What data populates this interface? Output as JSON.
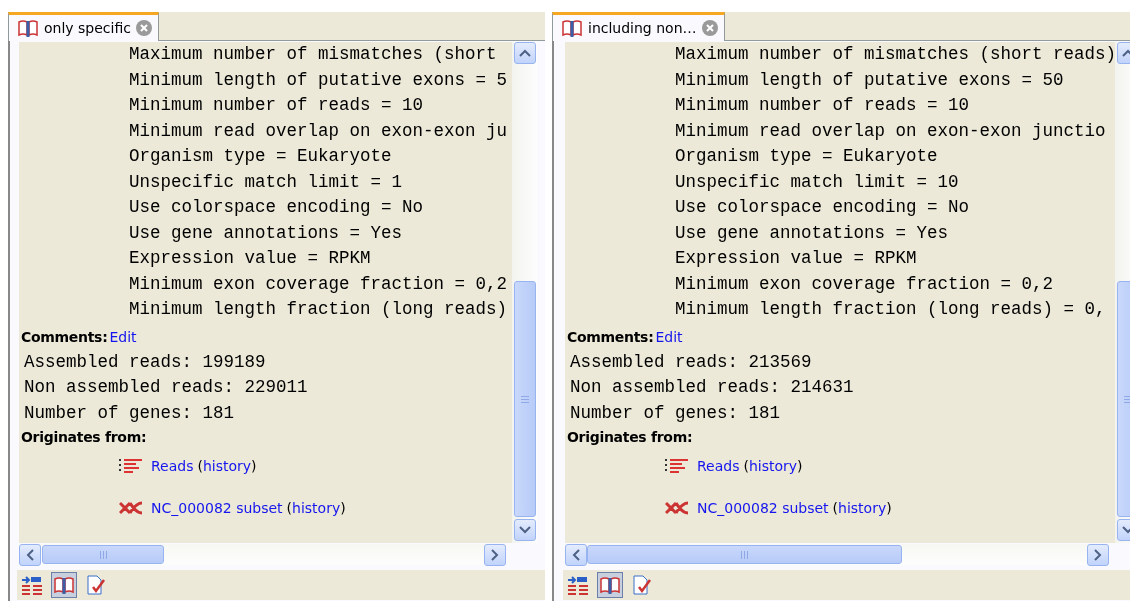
{
  "panels": [
    {
      "tab": {
        "label": "only specific",
        "selected": true
      },
      "parameters": [
        "Maximum number of mismatches (short",
        "Minimum length of putative exons = 5",
        "Minimum number of reads = 10",
        "Minimum read overlap on exon-exon ju",
        "Organism type = Eukaryote",
        "Unspecific match limit = 1",
        "Use colorspace encoding = No",
        "Use gene annotations = Yes",
        "Expression value = RPKM",
        "Minimum exon coverage fraction = 0,2",
        "Minimum length fraction (long reads)"
      ],
      "comments_label": "Comments:",
      "edit_link": "Edit",
      "stats": [
        "Assembled reads: 199189",
        "Non assembled reads: 229011",
        "Number of genes: 181"
      ],
      "originates_label": "Originates from:",
      "sources": [
        {
          "kind": "reads",
          "name": "Reads",
          "open": "(",
          "history_link": "history",
          "close": ")"
        },
        {
          "kind": "sequence",
          "name": "NC_000082 subset",
          "open": "(",
          "history_link": "history",
          "close": ")"
        }
      ],
      "toolbar": [
        {
          "kind": "structure",
          "selected": false
        },
        {
          "kind": "book",
          "selected": true
        },
        {
          "kind": "document",
          "selected": false
        }
      ]
    },
    {
      "tab": {
        "label": "including non…",
        "selected": true
      },
      "parameters": [
        "Maximum number of mismatches (short reads)",
        "Minimum length of putative exons = 50",
        "Minimum number of reads = 10",
        "Minimum read overlap on exon-exon junctio",
        "Organism type = Eukaryote",
        "Unspecific match limit = 10",
        "Use colorspace encoding = No",
        "Use gene annotations = Yes",
        "Expression value = RPKM",
        "Minimum exon coverage fraction = 0,2",
        "Minimum length fraction (long reads) = 0,"
      ],
      "comments_label": "Comments:",
      "edit_link": "Edit",
      "stats": [
        "Assembled reads: 213569",
        "Non assembled reads: 214631",
        "Number of genes: 181"
      ],
      "originates_label": "Originates from:",
      "sources": [
        {
          "kind": "reads",
          "name": "Reads",
          "open": "(",
          "history_link": "history",
          "close": ")"
        },
        {
          "kind": "sequence",
          "name": "NC_000082 subset",
          "open": "(",
          "history_link": "history",
          "close": ")"
        }
      ],
      "toolbar": [
        {
          "kind": "structure",
          "selected": false
        },
        {
          "kind": "book",
          "selected": true
        },
        {
          "kind": "document",
          "selected": false
        }
      ]
    }
  ]
}
